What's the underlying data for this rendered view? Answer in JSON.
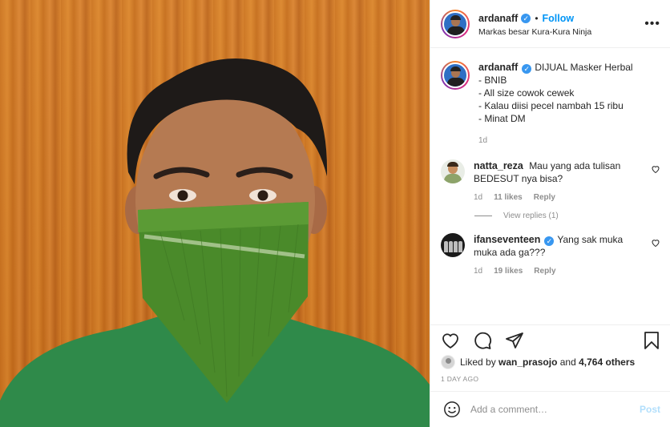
{
  "post": {
    "username": "ardanaff",
    "follow_label": "Follow",
    "separator": "•",
    "location": "Markas besar Kura-Kura Ninja",
    "more_label": "•••",
    "verified_glyph": "✓"
  },
  "caption": {
    "username": "ardanaff",
    "text": "DIJUAL Masker Herbal\n- BNIB\n- All size cowok cewek\n- Kalau diisi pecel nambah 15 ribu\n- Minat DM",
    "time": "1d"
  },
  "comments": [
    {
      "username": "natta_reza",
      "text": "Mau yang ada tulisan BEDESUT nya bisa?",
      "time": "1d",
      "likes": "11 likes",
      "reply_label": "Reply",
      "view_replies": "View replies (1)"
    },
    {
      "username": "ifanseventeen",
      "text": "Yang sak muka muka ada ga???",
      "time": "1d",
      "likes": "19 likes",
      "reply_label": "Reply"
    }
  ],
  "likes": {
    "prefix": "Liked by",
    "user": "wan_prasojo",
    "middle": "and",
    "count": "4,764 others"
  },
  "timestamp": "1 DAY AGO",
  "add_comment": {
    "placeholder": "Add a comment…",
    "post_label": "Post"
  },
  "icons": [
    "heart-icon",
    "comment-icon",
    "share-icon",
    "bookmark-icon",
    "emoji-icon",
    "verified-icon"
  ],
  "colors": {
    "accent": "#0095f6",
    "verified": "#3897f0",
    "muted": "#8e8e8e",
    "post_disabled": "#b2dffc",
    "mask_green": "#4a8a2a",
    "shirt_green": "#2f8a4a",
    "wall_orange": "#cf7a26"
  }
}
